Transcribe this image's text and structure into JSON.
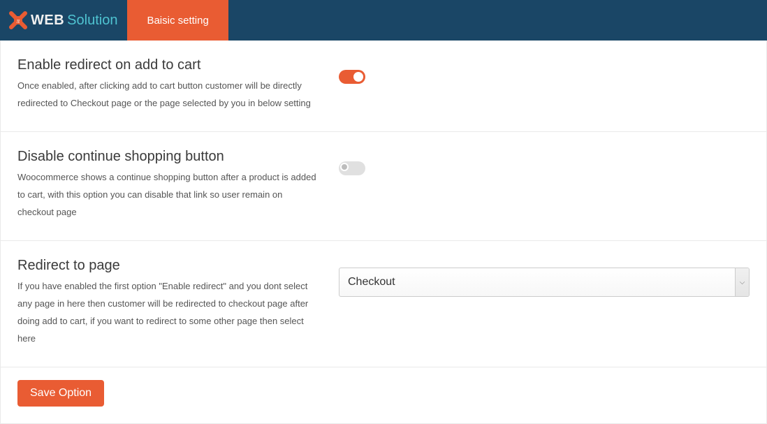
{
  "header": {
    "logo_web": "WEB",
    "logo_solution": "Solution",
    "tab_basic": "Baisic setting"
  },
  "settings": {
    "enable_redirect": {
      "title": "Enable redirect on add to cart",
      "desc": "Once enabled, after clicking add to cart button customer will be directly redirected to Checkout page or the page selected by you in below setting",
      "value": true
    },
    "disable_continue": {
      "title": "Disable continue shopping button",
      "desc": "Woocommerce shows a continue shopping button after a product is added to cart, with this option you can disable that link so user remain on checkout page",
      "value": false
    },
    "redirect_page": {
      "title": "Redirect to page",
      "desc": "If you have enabled the first option \"Enable redirect\" and you dont select any page in here then customer will be redirected to checkout page after doing add to cart, if you want to redirect to some other page then select here",
      "selected": "Checkout"
    }
  },
  "actions": {
    "save": "Save Option"
  }
}
